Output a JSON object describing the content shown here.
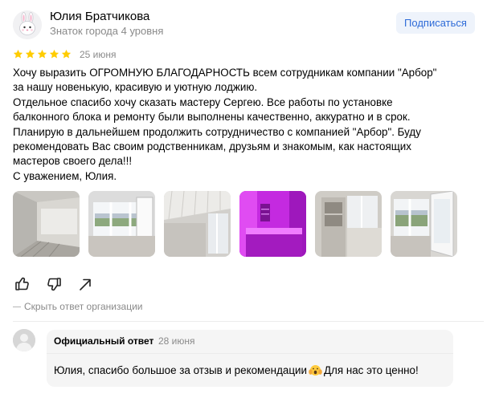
{
  "author": {
    "name": "Юлия Братчикова",
    "level": "Знаток города 4 уровня",
    "avatar_icon": "bunny-avatar-icon"
  },
  "subscribe_label": "Подписаться",
  "review": {
    "rating": 5,
    "date": "25 июня",
    "lines": [
      "Хочу выразить ОГРОМНУЮ БЛАГОДАРНОСТЬ всем сотрудникам компании \"Арбор\"",
      "за нашу новенькую, красивую и уютную лоджию.",
      "Отдельное спасибо хочу сказать мастеру Сергею. Все работы по установке",
      "балконного блока и ремонту были выполнены качественно, аккуратно и в срок.",
      "Планирую в дальнейшем продолжить сотрудничество с компанией \"Арбор\". Буду",
      "рекомендовать Вас своим родственникам, друзьям и знакомым, как настоящих",
      "мастеров своего дела!!!",
      "С уважением, Юлия."
    ]
  },
  "photos": [
    {
      "description": "balcony-interior-photo"
    },
    {
      "description": "balcony-window-view-photo"
    },
    {
      "description": "balcony-ceiling-photo"
    },
    {
      "description": "balcony-purple-light-photo"
    },
    {
      "description": "balcony-shelf-photo"
    },
    {
      "description": "balcony-open-window-photo"
    }
  ],
  "actions": [
    "like-icon",
    "dislike-icon",
    "share-icon"
  ],
  "hide_reply_label": "Скрыть ответ организации",
  "org_reply": {
    "title": "Официальный ответ",
    "date": "28 июня",
    "text_before": "Юлия, спасибо большое за отзыв и рекомендации",
    "emoji": "face-with-hands-emoji",
    "text_after": "Для нас это ценно!"
  },
  "colors": {
    "accent": "#2e6bd8",
    "star": "#ffcc00",
    "muted": "#8a8a8a",
    "reply_bg": "#f5f5f5",
    "photo_purple": "#c42ae0"
  }
}
